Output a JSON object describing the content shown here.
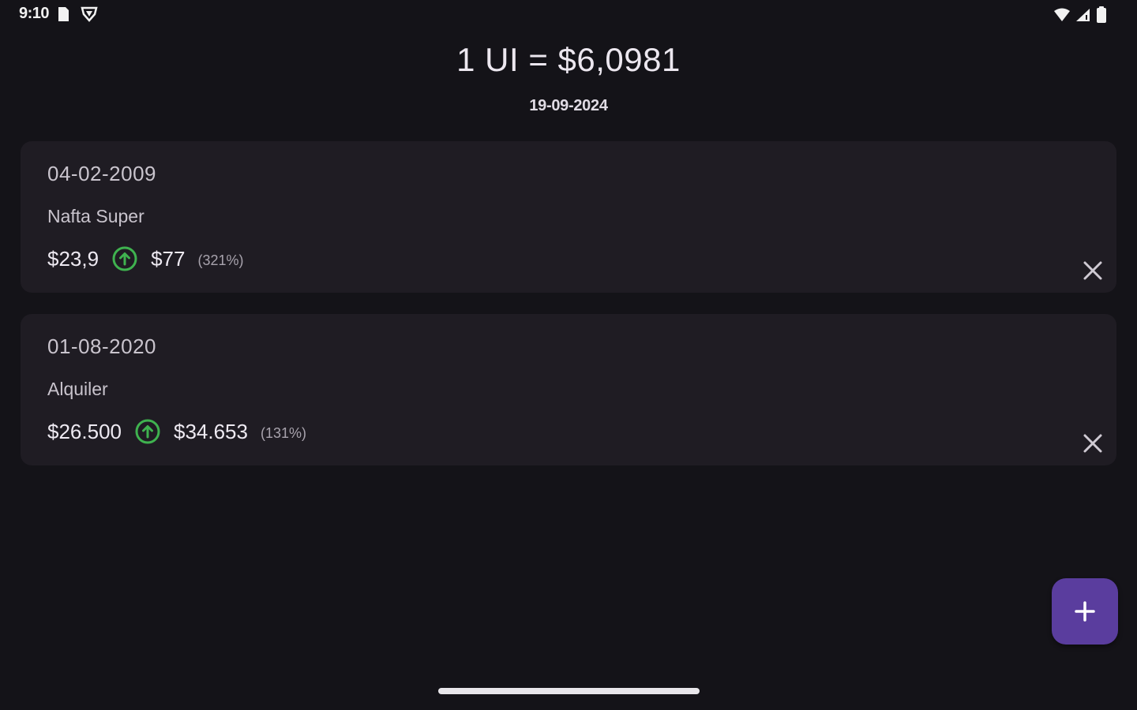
{
  "status_bar": {
    "time": "9:10",
    "left_icons": [
      "sim-card-icon",
      "shield-icon"
    ],
    "right_icons": [
      "wifi-icon",
      "signal-icon",
      "battery-icon"
    ]
  },
  "header": {
    "title": "1 UI = $6,0981",
    "date": "19-09-2024"
  },
  "entries": [
    {
      "date": "04-02-2009",
      "name": "Nafta Super",
      "value_from": "$23,9",
      "value_to": "$77",
      "percent": "(321%)",
      "trend_icon": "arrow-up-circle-icon",
      "delete_icon": "close-icon"
    },
    {
      "date": "01-08-2020",
      "name": "Alquiler",
      "value_from": "$26.500",
      "value_to": "$34.653",
      "percent": "(131%)",
      "trend_icon": "arrow-up-circle-icon",
      "delete_icon": "close-icon"
    }
  ],
  "fab": {
    "icon": "plus-icon"
  },
  "colors": {
    "background": "#141318",
    "card": "#1f1c23",
    "accent": "#5a3d9e",
    "trend_up": "#3fb24f"
  }
}
